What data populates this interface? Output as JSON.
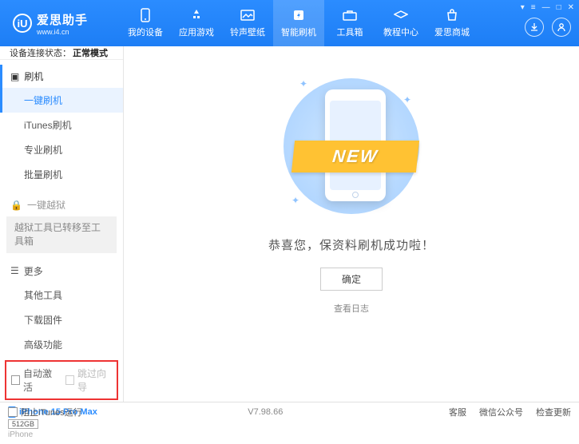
{
  "header": {
    "app_name": "爱思助手",
    "app_url": "www.i4.cn",
    "nav": [
      {
        "label": "我的设备"
      },
      {
        "label": "应用游戏"
      },
      {
        "label": "铃声壁纸"
      },
      {
        "label": "智能刷机"
      },
      {
        "label": "工具箱"
      },
      {
        "label": "教程中心"
      },
      {
        "label": "爱思商城"
      }
    ]
  },
  "sidebar": {
    "conn_label": "设备连接状态：",
    "conn_value": "正常模式",
    "section_flash": "刷机",
    "items_flash": [
      "一键刷机",
      "iTunes刷机",
      "专业刷机",
      "批量刷机"
    ],
    "section_jailbreak": "一键越狱",
    "jailbreak_note": "越狱工具已转移至工具箱",
    "section_more": "更多",
    "items_more": [
      "其他工具",
      "下载固件",
      "高级功能"
    ],
    "chk_auto_activate": "自动激活",
    "chk_skip_guide": "跳过向导",
    "device_name": "iPhone 15 Pro Max",
    "device_storage": "512GB",
    "device_type": "iPhone"
  },
  "main": {
    "ribbon": "NEW",
    "success_msg": "恭喜您，保资料刷机成功啦！",
    "ok": "确定",
    "view_log": "查看日志"
  },
  "footer": {
    "block_itunes": "阻止iTunes运行",
    "version": "V7.98.66",
    "links": [
      "客服",
      "微信公众号",
      "检查更新"
    ]
  }
}
